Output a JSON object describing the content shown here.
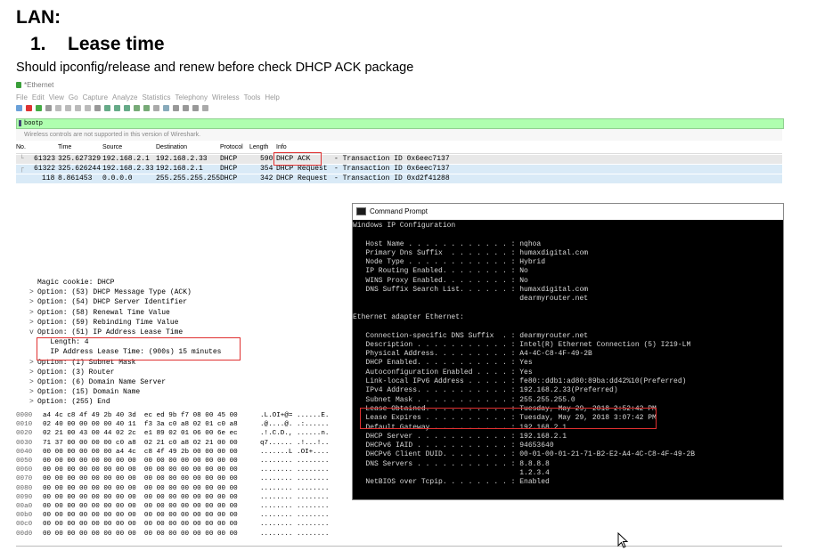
{
  "doc": {
    "heading": "LAN:",
    "list_number": "1.",
    "subheading": "Lease time",
    "instruction": "Should ipconfig/release and renew before check DHCP ACK package"
  },
  "wireshark": {
    "window_title": "*Ethernet",
    "menu": [
      "File",
      "Edit",
      "View",
      "Go",
      "Capture",
      "Analyze",
      "Statistics",
      "Telephony",
      "Wireless",
      "Tools",
      "Help"
    ],
    "filter": "bootp",
    "notice": "Wireless controls are not supported in this version of Wireshark.",
    "columns": [
      "No.",
      "Time",
      "Source",
      "Destination",
      "Protocol",
      "Length",
      "Info"
    ],
    "packets": [
      {
        "no": "61323",
        "time": "325.627329",
        "src": "192.168.2.1",
        "dst": "192.168.2.33",
        "proto": "DHCP",
        "len": "590",
        "info": "DHCP ACK",
        "extra": "- Transaction ID 0x6eec7137"
      },
      {
        "no": "61322",
        "time": "325.626244",
        "src": "192.168.2.33",
        "dst": "192.168.2.1",
        "proto": "DHCP",
        "len": "354",
        "info": "DHCP Request",
        "extra": "- Transaction ID 0x6eec7137"
      },
      {
        "no": "118",
        "time": "8.861453",
        "src": "0.0.0.0",
        "dst": "255.255.255.255",
        "proto": "DHCP",
        "len": "342",
        "info": "DHCP Request",
        "extra": "- Transaction ID 0xd2f41288"
      }
    ],
    "details": [
      {
        "chev": "",
        "text": "Magic cookie: DHCP"
      },
      {
        "chev": ">",
        "text": "Option: (53) DHCP Message Type (ACK)"
      },
      {
        "chev": ">",
        "text": "Option: (54) DHCP Server Identifier"
      },
      {
        "chev": ">",
        "text": "Option: (58) Renewal Time Value"
      },
      {
        "chev": ">",
        "text": "Option: (59) Rebinding Time Value"
      },
      {
        "chev": "v",
        "text": "Option: (51) IP Address Lease Time"
      },
      {
        "chev": "",
        "text": "   Length: 4"
      },
      {
        "chev": "",
        "text": "   IP Address Lease Time: (900s) 15 minutes"
      },
      {
        "chev": ">",
        "text": "Option: (1) Subnet Mask"
      },
      {
        "chev": ">",
        "text": "Option: (3) Router"
      },
      {
        "chev": ">",
        "text": "Option: (6) Domain Name Server"
      },
      {
        "chev": ">",
        "text": "Option: (15) Domain Name"
      },
      {
        "chev": ">",
        "text": "Option: (255) End"
      }
    ],
    "hex": [
      {
        "off": "0000",
        "bytes": "a4 4c c8 4f 49 2b 40 3d  ec ed 9b f7 08 00 45 00",
        "ascii": ".L.OI+@= ......E."
      },
      {
        "off": "0010",
        "bytes": "02 40 00 00 00 00 40 11  f3 3a c0 a8 02 01 c0 a8",
        "ascii": ".@....@. .:......"
      },
      {
        "off": "0020",
        "bytes": "02 21 00 43 00 44 02 2c  e1 89 02 01 06 00 6e ec",
        "ascii": ".!.C.D., ......n."
      },
      {
        "off": "0030",
        "bytes": "71 37 00 00 00 00 c0 a8  02 21 c0 a8 02 21 00 00",
        "ascii": "q7...... .!...!.."
      },
      {
        "off": "0040",
        "bytes": "00 00 00 00 00 00 a4 4c  c8 4f 49 2b 00 00 00 00",
        "ascii": ".......L .OI+...."
      },
      {
        "off": "0050",
        "bytes": "00 00 00 00 00 00 00 00  00 00 00 00 00 00 00 00",
        "ascii": "........ ........"
      },
      {
        "off": "0060",
        "bytes": "00 00 00 00 00 00 00 00  00 00 00 00 00 00 00 00",
        "ascii": "........ ........"
      },
      {
        "off": "0070",
        "bytes": "00 00 00 00 00 00 00 00  00 00 00 00 00 00 00 00",
        "ascii": "........ ........"
      },
      {
        "off": "0080",
        "bytes": "00 00 00 00 00 00 00 00  00 00 00 00 00 00 00 00",
        "ascii": "........ ........"
      },
      {
        "off": "0090",
        "bytes": "00 00 00 00 00 00 00 00  00 00 00 00 00 00 00 00",
        "ascii": "........ ........"
      },
      {
        "off": "00a0",
        "bytes": "00 00 00 00 00 00 00 00  00 00 00 00 00 00 00 00",
        "ascii": "........ ........"
      },
      {
        "off": "00b0",
        "bytes": "00 00 00 00 00 00 00 00  00 00 00 00 00 00 00 00",
        "ascii": "........ ........"
      },
      {
        "off": "00c0",
        "bytes": "00 00 00 00 00 00 00 00  00 00 00 00 00 00 00 00",
        "ascii": "........ ........"
      },
      {
        "off": "00d0",
        "bytes": "00 00 00 00 00 00 00 00  00 00 00 00 00 00 00 00",
        "ascii": "........ ........"
      }
    ]
  },
  "cmd": {
    "title": "Command Prompt",
    "lines": [
      "Windows IP Configuration",
      "",
      "   Host Name . . . . . . . . . . . . : nqhoa",
      "   Primary Dns Suffix  . . . . . . . : humaxdigital.com",
      "   Node Type . . . . . . . . . . . . : Hybrid",
      "   IP Routing Enabled. . . . . . . . : No",
      "   WINS Proxy Enabled. . . . . . . . : No",
      "   DNS Suffix Search List. . . . . . : humaxdigital.com",
      "                                       dearmyrouter.net",
      "",
      "Ethernet adapter Ethernet:",
      "",
      "   Connection-specific DNS Suffix  . : dearmyrouter.net",
      "   Description . . . . . . . . . . . : Intel(R) Ethernet Connection (5) I219-LM",
      "   Physical Address. . . . . . . . . : A4-4C-C8-4F-49-2B",
      "   DHCP Enabled. . . . . . . . . . . : Yes",
      "   Autoconfiguration Enabled . . . . : Yes",
      "   Link-local IPv6 Address . . . . . : fe80::ddb1:ad80:89ba:dd42%10(Preferred)",
      "   IPv4 Address. . . . . . . . . . . : 192.168.2.33(Preferred)",
      "   Subnet Mask . . . . . . . . . . . : 255.255.255.0",
      "   Lease Obtained. . . . . . . . . . : Tuesday, May 29, 2018 2:52:42 PM",
      "   Lease Expires . . . . . . . . . . : Tuesday, May 29, 2018 3:07:42 PM",
      "   Default Gateway . . . . . . . . . : 192.168.2.1",
      "   DHCP Server . . . . . . . . . . . : 192.168.2.1",
      "   DHCPv6 IAID . . . . . . . . . . . : 94653640",
      "   DHCPv6 Client DUID. . . . . . . . : 00-01-00-01-21-71-B2-E2-A4-4C-C8-4F-49-2B",
      "   DNS Servers . . . . . . . . . . . : 8.8.8.8",
      "                                       1.2.3.4",
      "   NetBIOS over Tcpip. . . . . . . . : Enabled"
    ]
  },
  "colors": {
    "highlight_box": "#e03030",
    "filter_bg": "#afffaf",
    "cmd_bg": "#000000"
  }
}
